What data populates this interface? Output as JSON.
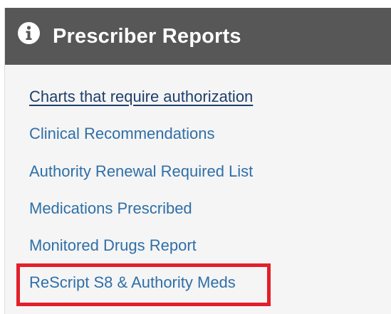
{
  "header": {
    "title": "Prescriber Reports",
    "icon": "info-circle-icon"
  },
  "reports": [
    {
      "label": "Charts that require authorization",
      "active": true
    },
    {
      "label": "Clinical Recommendations",
      "active": false
    },
    {
      "label": "Authority Renewal Required List",
      "active": false
    },
    {
      "label": "Medications Prescribed",
      "active": false
    },
    {
      "label": "Monitored Drugs Report",
      "active": false
    },
    {
      "label": "ReScript S8 & Authority Meds",
      "active": false,
      "highlighted": true
    }
  ],
  "colors": {
    "header_bg": "#575757",
    "link": "#2f6fa7",
    "link_active": "#1f3f6b",
    "highlight": "#e3202a"
  }
}
